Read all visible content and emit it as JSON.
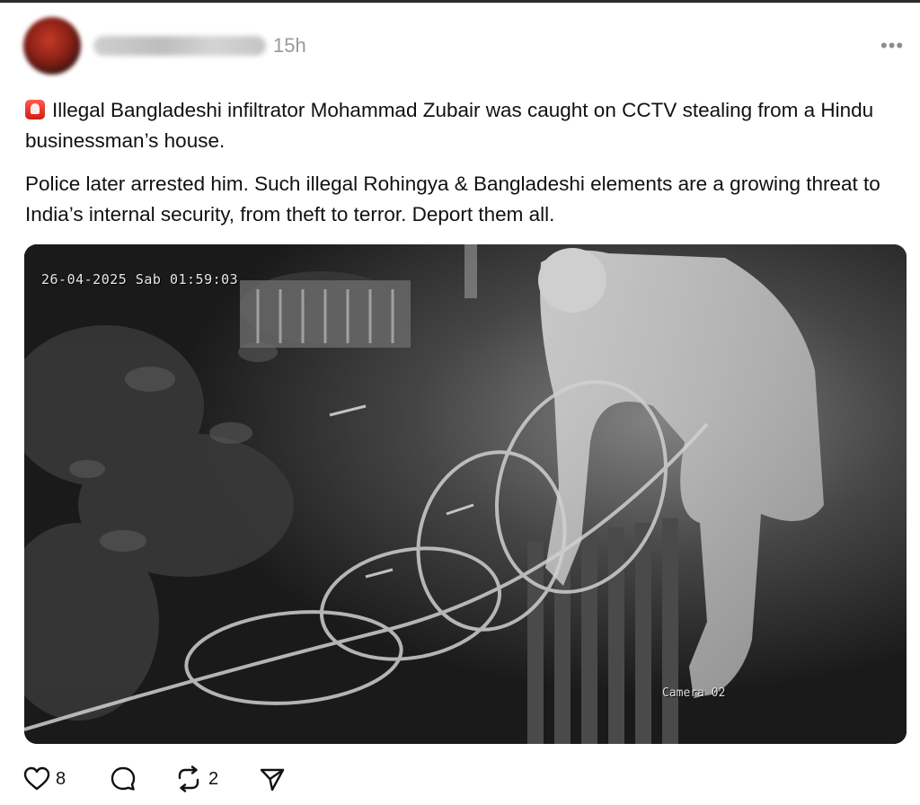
{
  "post": {
    "author": "deepakkrsbkarr",
    "time": "15h",
    "more_label": "•••",
    "paragraphs": [
      "Illegal Bangladeshi infiltrator Mohammad Zubair was caught on CCTV stealing from a Hindu businessman’s house.",
      "Police later arrested him. Such illegal Rohingya & Bangladeshi elements are a growing threat to India’s internal security, from theft to terror. Deport them all."
    ],
    "emoji_icon": "police-siren-icon"
  },
  "video": {
    "timestamp": "26-04-2025 Sab 01:59:03",
    "camera_label": "Camera 02"
  },
  "actions": {
    "like_count": "8",
    "reply_count": "",
    "repost_count": "2",
    "icons": [
      "heart-icon",
      "reply-bubble-icon",
      "repost-icon",
      "share-send-icon"
    ]
  },
  "colors": {
    "text": "#111111",
    "muted": "#9a9a9a",
    "background": "#ffffff"
  }
}
